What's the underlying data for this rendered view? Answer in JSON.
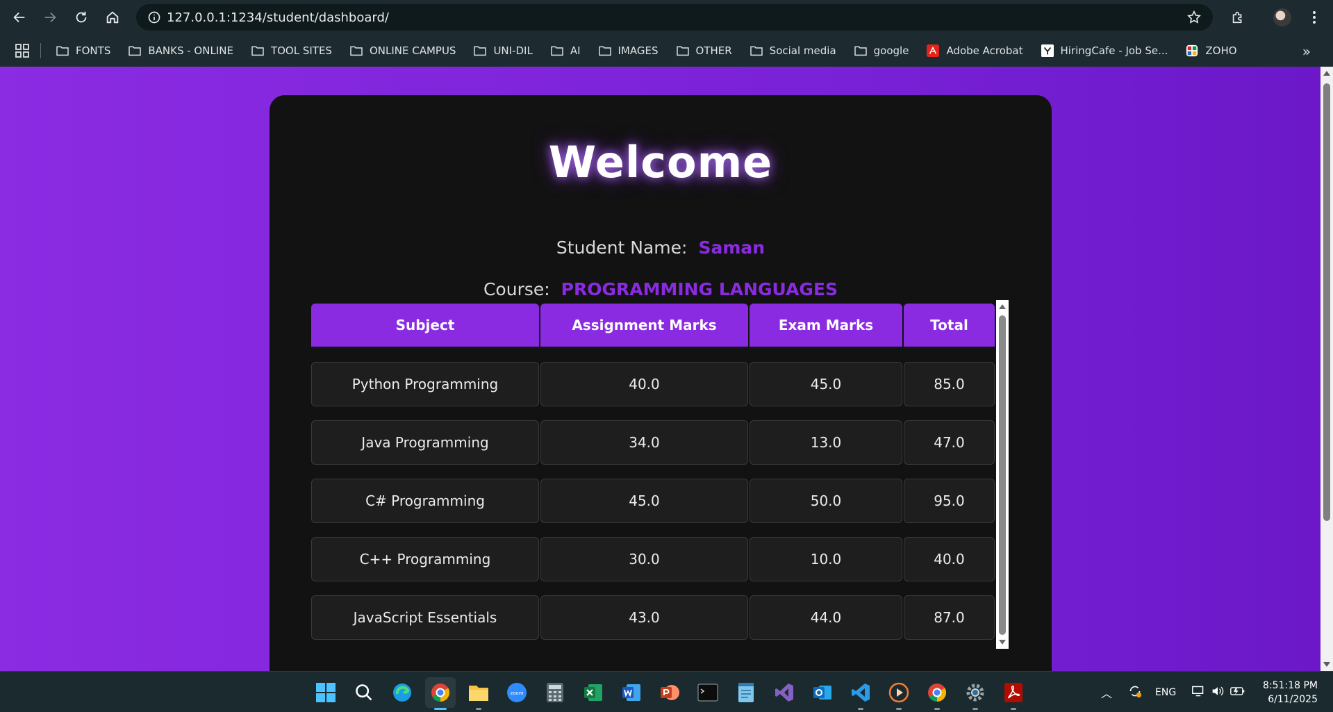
{
  "browser": {
    "url": "127.0.0.1:1234/student/dashboard/"
  },
  "bookmarks": [
    {
      "label": "FONTS",
      "icon": "folder-icon"
    },
    {
      "label": "BANKS - ONLINE",
      "icon": "folder-icon"
    },
    {
      "label": "TOOL SITES",
      "icon": "folder-icon"
    },
    {
      "label": "ONLINE CAMPUS",
      "icon": "folder-icon"
    },
    {
      "label": "UNI-DIL",
      "icon": "folder-icon"
    },
    {
      "label": "AI",
      "icon": "folder-icon"
    },
    {
      "label": "IMAGES",
      "icon": "folder-icon"
    },
    {
      "label": "OTHER",
      "icon": "folder-icon"
    },
    {
      "label": "Social media",
      "icon": "folder-icon"
    },
    {
      "label": "google",
      "icon": "folder-icon"
    },
    {
      "label": "Adobe Acrobat",
      "icon": "acrobat-icon"
    },
    {
      "label": "HiringCafe - Job Se...",
      "icon": "hiringcafe-icon"
    },
    {
      "label": "ZOHO",
      "icon": "zoho-icon"
    }
  ],
  "dashboard": {
    "title": "Welcome",
    "student_label": "Student Name:",
    "student_name": "Saman",
    "course_label": "Course:",
    "course_name": "PROGRAMMING LANGUAGES",
    "columns": [
      "Subject",
      "Assignment Marks",
      "Exam Marks",
      "Total"
    ],
    "rows": [
      [
        "Python Programming",
        "40.0",
        "45.0",
        "85.0"
      ],
      [
        "Java Programming",
        "34.0",
        "13.0",
        "47.0"
      ],
      [
        "C# Programming",
        "45.0",
        "50.0",
        "95.0"
      ],
      [
        "C++ Programming",
        "30.0",
        "10.0",
        "40.0"
      ],
      [
        "JavaScript Essentials",
        "43.0",
        "44.0",
        "87.0"
      ]
    ]
  },
  "taskbar": {
    "apps": [
      "windows-start-icon",
      "search-icon",
      "edge-icon",
      "chrome-icon",
      "file-explorer-icon",
      "zoom-icon",
      "calculator-icon",
      "excel-icon",
      "word-icon",
      "powerpoint-icon",
      "terminal-icon",
      "notepad-icon",
      "visual-studio-icon",
      "outlook-icon",
      "vscode-icon",
      "media-player-icon",
      "chrome-alt-icon",
      "settings-icon",
      "acrobat-taskbar-icon"
    ],
    "language": "ENG",
    "time": "8:51:18 PM",
    "date": "6/11/2025"
  },
  "colors": {
    "accent": "#8a2be2",
    "page_bg": "#7a22d8",
    "card_bg": "#121212"
  }
}
